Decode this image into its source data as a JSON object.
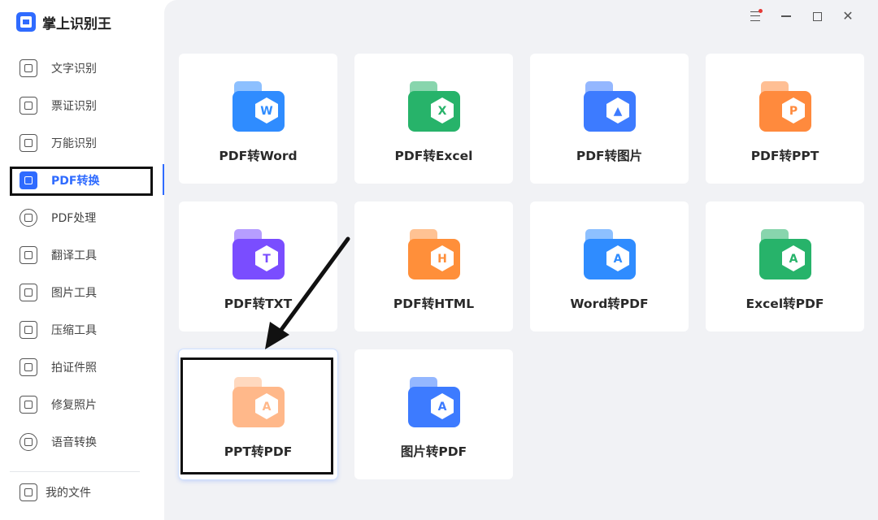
{
  "app": {
    "title": "掌上识别王"
  },
  "sidebar": {
    "items": [
      {
        "label": "文字识别",
        "icon": "text-recognition-icon"
      },
      {
        "label": "票证识别",
        "icon": "ticket-recognition-icon"
      },
      {
        "label": "万能识别",
        "icon": "universal-recognition-icon"
      },
      {
        "label": "PDF转换",
        "icon": "pdf-convert-icon"
      },
      {
        "label": "PDF处理",
        "icon": "pdf-process-icon"
      },
      {
        "label": "翻译工具",
        "icon": "translate-icon"
      },
      {
        "label": "图片工具",
        "icon": "image-tool-icon"
      },
      {
        "label": "压缩工具",
        "icon": "compress-icon"
      },
      {
        "label": "拍证件照",
        "icon": "id-photo-icon"
      },
      {
        "label": "修复照片",
        "icon": "photo-repair-icon"
      },
      {
        "label": "语音转换",
        "icon": "voice-convert-icon"
      }
    ],
    "active_index": 3,
    "files_label": "我的文件"
  },
  "window": {
    "controls": [
      "menu-icon",
      "minimize-icon",
      "maximize-icon",
      "close-icon"
    ]
  },
  "tools": [
    {
      "label": "PDF转Word",
      "badge": "W",
      "color": "#2f8cff"
    },
    {
      "label": "PDF转Excel",
      "badge": "X",
      "color": "#27b36a"
    },
    {
      "label": "PDF转图片",
      "badge": "▲",
      "color": "#3d7bff"
    },
    {
      "label": "PDF转PPT",
      "badge": "P",
      "color": "#ff8a3d"
    },
    {
      "label": "PDF转TXT",
      "badge": "T",
      "color": "#7a4dff"
    },
    {
      "label": "PDF转HTML",
      "badge": "H",
      "color": "#ff8f3a"
    },
    {
      "label": "Word转PDF",
      "badge": "A",
      "color": "#2f8cff"
    },
    {
      "label": "Excel转PDF",
      "badge": "A",
      "color": "#27b36a"
    },
    {
      "label": "PPT转PDF",
      "badge": "A",
      "color": "#ff8a3d"
    },
    {
      "label": "图片转PDF",
      "badge": "A",
      "color": "#3d7bff"
    }
  ],
  "selected_tool_index": 8,
  "colors": {
    "accent": "#2f6bff",
    "main_bg": "#f1f2f5"
  }
}
